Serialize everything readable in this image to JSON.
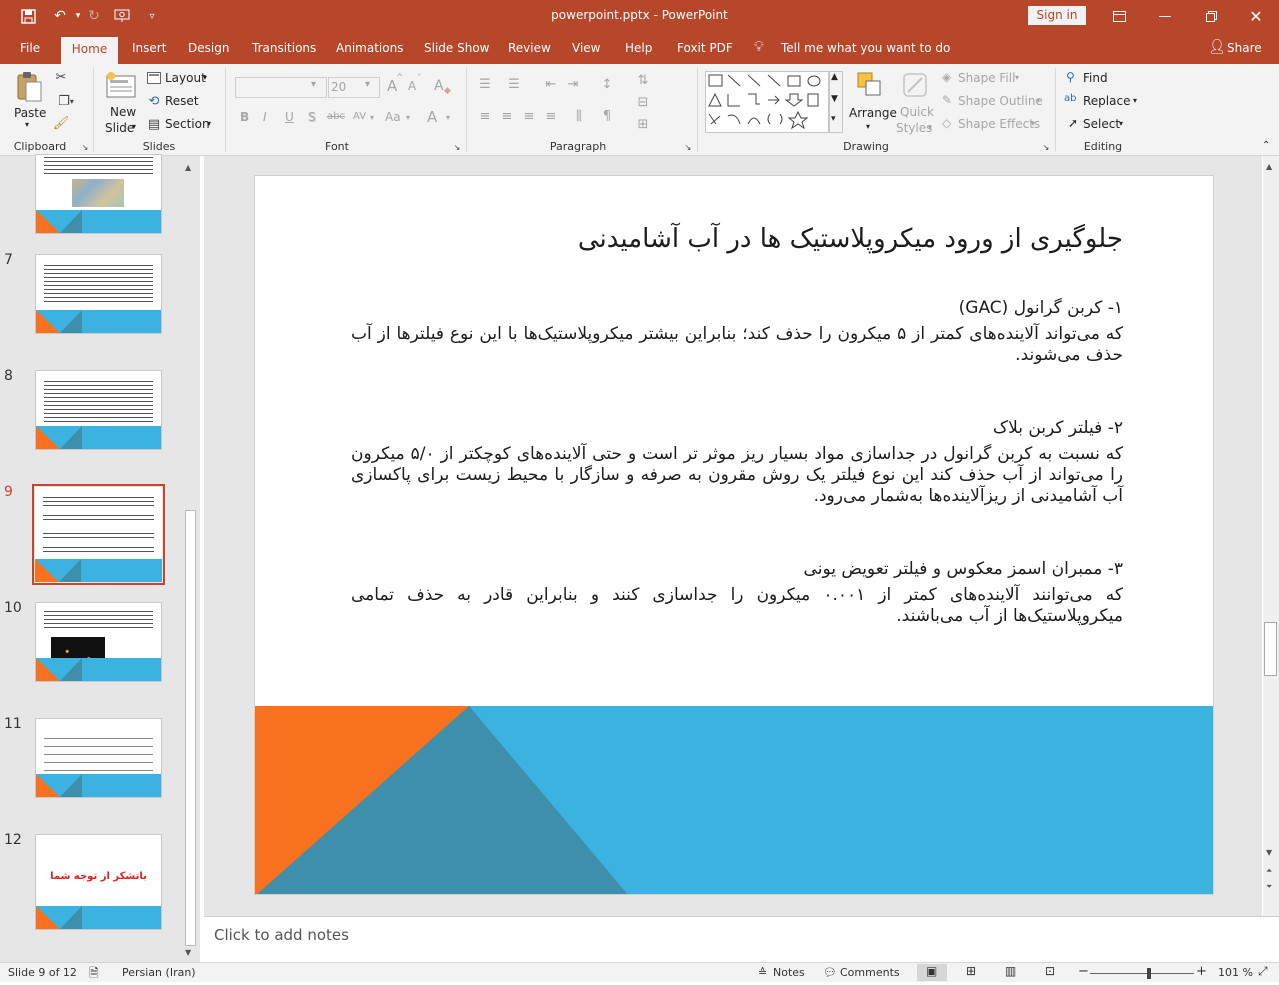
{
  "app": {
    "doc_title": "powerpoint.pptx",
    "separator": "-",
    "app_name": "PowerPoint",
    "signin_label": "Sign in"
  },
  "tabs": [
    "File",
    "Home",
    "Insert",
    "Design",
    "Transitions",
    "Animations",
    "Slide Show",
    "Review",
    "View",
    "Help",
    "Foxit PDF",
    "Tell me what you want to do",
    "Share"
  ],
  "ribbon": {
    "clipboard": {
      "paste": "Paste",
      "label": "Clipboard"
    },
    "slides": {
      "new_slide_1": "New",
      "new_slide_2": "Slide",
      "layout": "Layout",
      "reset": "Reset",
      "section": "Section",
      "label": "Slides"
    },
    "font": {
      "size": "20",
      "bold": "B",
      "italic": "I",
      "underline": "U",
      "shadow": "S",
      "strike": "abc",
      "spacing": "AV",
      "case": "Aa",
      "color": "A",
      "grow": "A",
      "shrink": "A",
      "clear": "A",
      "label": "Font"
    },
    "paragraph": {
      "label": "Paragraph"
    },
    "drawing": {
      "arrange": "Arrange",
      "quick_styles_1": "Quick",
      "quick_styles_2": "Styles",
      "shape_fill": "Shape Fill",
      "shape_outline": "Shape Outline",
      "shape_effects": "Shape Effects",
      "label": "Drawing"
    },
    "editing": {
      "find": "Find",
      "replace": "Replace",
      "select": "Select",
      "label": "Editing"
    },
    "accent": "#b7472a"
  },
  "thumbnails": {
    "numbers": [
      "7",
      "8",
      "9",
      "10",
      "11",
      "12"
    ],
    "slide12_text": "باتشکر از توجه شما",
    "selected": "9"
  },
  "slide": {
    "title": "جلوگیری از ورود میکروپلاستیک ها در آب آشامیدنی",
    "items": [
      {
        "heading": "۱- کربن گرانول (GAC)",
        "body": "که می‌تواند آلاینده‌های کمتر از ۵ میکرون را حذف کند؛ بنابراین بیشتر میکروپلاستیک‌ها با این نوع فیلترها از آب حذف می‌شوند."
      },
      {
        "heading": "۲- فیلتر کربن بلاک",
        "body": "که نسبت به کربن گرانول در جداسازی مواد بسیار ریز موثر تر است و حتی آلاینده‌های کوچکتر از ۵/۰ میکرون را می‌تواند از آب حذف کند این نوع فیلتر یک روش مقرون به صرفه و سازگار با محیط زیست برای پاکسازی آب آشامیدنی از ریزآلاینده‌ها به‌شمار می‌رود."
      },
      {
        "heading": "۳- ممبران اسمز معکوس و فیلتر تعویض یونی",
        "body": "که می‌توانند آلاینده‌های کمتر از ۰.۰۰۱ میکرون را جداسازی کنند و بنابراین قادر به حذف تمامی میکروپلاستیک‌ها از آب می‌باشند."
      }
    ],
    "colors": {
      "blue": "#3bb2e0",
      "orange": "#f7711f",
      "steel": "#3d8fac"
    }
  },
  "notes": {
    "placeholder": "Click to add notes"
  },
  "status": {
    "slide_info": "Slide 9 of 12",
    "language": "Persian (Iran)",
    "notes": "Notes",
    "comments": "Comments",
    "zoom": "101 %",
    "zoom_level": 0.57
  }
}
